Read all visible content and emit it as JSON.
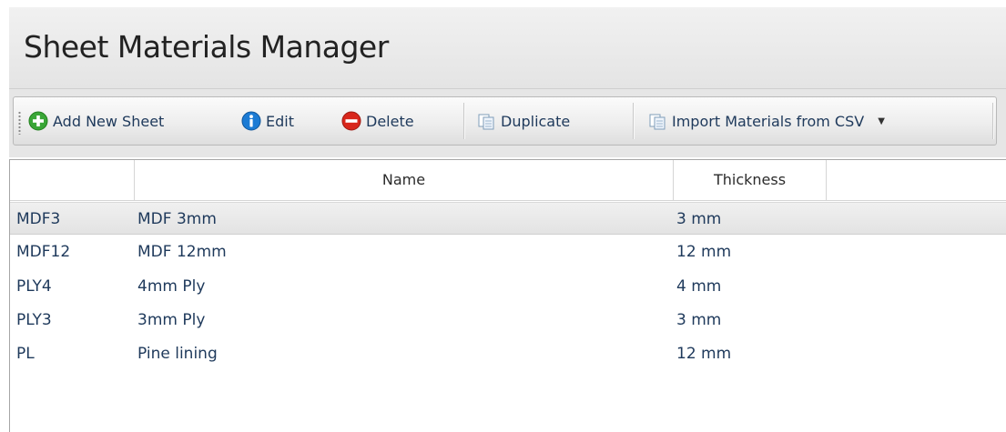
{
  "app": {
    "title": "Sheet Materials Manager"
  },
  "toolbar": {
    "add_label": "Add New Sheet",
    "edit_label": "Edit",
    "delete_label": "Delete",
    "duplicate_label": "Duplicate",
    "import_label": "Import Materials from CSV"
  },
  "table": {
    "columns": [
      "",
      "Name",
      "Thickness",
      ""
    ],
    "rows": [
      {
        "code": "MDF3",
        "name": "MDF 3mm",
        "thickness": "3 mm",
        "selected": true
      },
      {
        "code": "MDF12",
        "name": "MDF 12mm",
        "thickness": "12 mm",
        "selected": false
      },
      {
        "code": "PLY4",
        "name": "4mm Ply",
        "thickness": "4 mm",
        "selected": false
      },
      {
        "code": "PLY3",
        "name": "3mm Ply",
        "thickness": "3 mm",
        "selected": false
      },
      {
        "code": "PL",
        "name": "Pine lining",
        "thickness": "12 mm",
        "selected": false
      }
    ]
  },
  "icons": {
    "add": "plus-circle-icon",
    "edit": "info-icon",
    "delete": "minus-circle-icon",
    "duplicate": "copy-icon",
    "import": "copy-icon",
    "dropdown": "chevron-down-icon"
  },
  "colors": {
    "add_icon": "#3aa637",
    "edit_icon": "#1c7bd4",
    "delete_icon": "#d8261b",
    "text_blue": "#1e395b",
    "selected_row": "#e8e8e8"
  }
}
